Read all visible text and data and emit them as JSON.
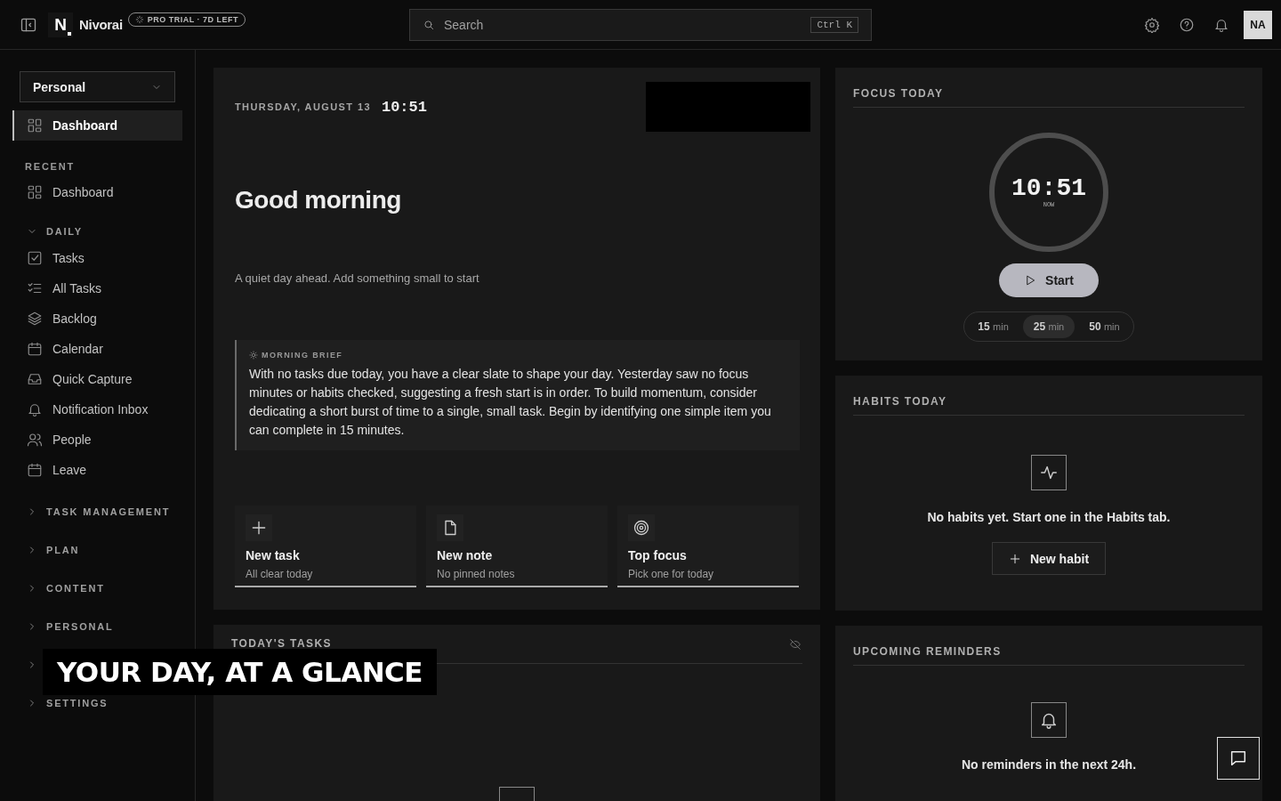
{
  "topbar": {
    "logo_letter": "N",
    "brand": "Nivorai",
    "trial_badge": "PRO TRIAL · 7D LEFT",
    "search": {
      "placeholder": "Search",
      "shortcut": "Ctrl K"
    },
    "avatar": "NA"
  },
  "sidebar": {
    "workspace": "Personal",
    "nav": [
      {
        "label": "Dashboard",
        "kind": "grid",
        "selected": true
      }
    ],
    "recent_title": "RECENT",
    "recent": [
      {
        "label": "Dashboard",
        "kind": "grid"
      }
    ],
    "groups": [
      {
        "title": "DAILY",
        "expanded": true,
        "items": [
          {
            "label": "Tasks",
            "kind": "checkbox"
          },
          {
            "label": "All Tasks",
            "kind": "checklist"
          },
          {
            "label": "Backlog",
            "kind": "layers"
          },
          {
            "label": "Calendar",
            "kind": "calendar"
          },
          {
            "label": "Quick Capture",
            "kind": "inbox"
          },
          {
            "label": "Notification Inbox",
            "kind": "bell"
          },
          {
            "label": "People",
            "kind": "people"
          },
          {
            "label": "Leave",
            "kind": "calendar"
          }
        ]
      },
      {
        "title": "TASK MANAGEMENT",
        "expanded": false
      },
      {
        "title": "PLAN",
        "expanded": false
      },
      {
        "title": "CONTENT",
        "expanded": false
      },
      {
        "title": "PERSONAL",
        "expanded": false
      },
      {
        "expanded": false
      },
      {
        "title": "SETTINGS",
        "expanded": false
      }
    ]
  },
  "greeting": {
    "date": "THURSDAY, AUGUST 13",
    "time": "10:51",
    "heading": "Good morning",
    "subtitle": "A quiet day ahead. Add something small to start",
    "brief": {
      "title": "MORNING BRIEF",
      "text": "With no tasks due today, you have a clear slate to shape your day. Yesterday saw no focus minutes or habits checked, suggesting a fresh start is in order. To build momentum, consider dedicating a short burst of time to a single, small task. Begin by identifying one simple item you can complete in 15 minutes."
    },
    "quick_actions": [
      {
        "kind": "plus",
        "title": "New task",
        "subtitle": "All clear today"
      },
      {
        "kind": "note",
        "title": "New note",
        "subtitle": "No pinned notes"
      },
      {
        "kind": "target",
        "title": "Top focus",
        "subtitle": "Pick one for today"
      }
    ]
  },
  "todays_tasks": {
    "title": "TODAY'S TASKS"
  },
  "focus": {
    "title": "FOCUS TODAY",
    "time": "10:51",
    "caption": "NOW",
    "start": "Start",
    "durations": [
      {
        "value": "15",
        "unit": "min",
        "selected": false
      },
      {
        "value": "25",
        "unit": "min",
        "selected": true
      },
      {
        "value": "50",
        "unit": "min",
        "selected": false
      }
    ]
  },
  "habits": {
    "title": "HABITS TODAY",
    "empty_text": "No habits yet. Start one in the Habits tab.",
    "button": "New habit"
  },
  "reminders": {
    "title": "UPCOMING REMINDERS",
    "empty_text": "No reminders in the next 24h."
  },
  "caption": "YOUR DAY, AT A GLANCE"
}
